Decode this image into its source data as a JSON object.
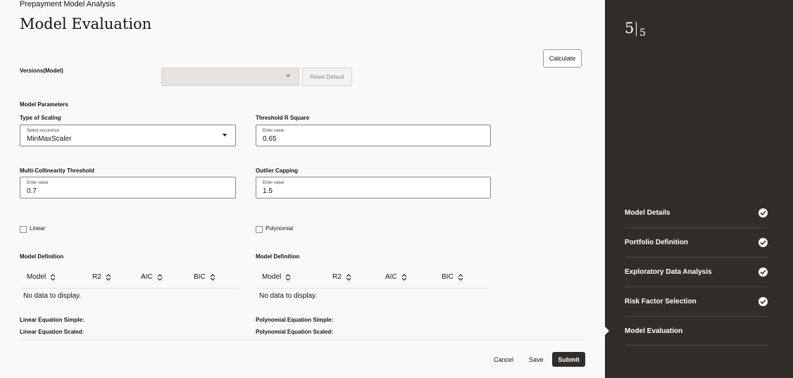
{
  "breadcrumb": "Prepayment Model Analysis",
  "page_title": "Model Evaluation",
  "buttons": {
    "calculate": "Calculate",
    "reset_default": "Reset Default",
    "cancel": "Cancel",
    "save": "Save",
    "submit": "Submit"
  },
  "versions": {
    "label": "Versions(Model)",
    "value": ""
  },
  "model_parameters": {
    "section_label": "Model Parameters",
    "scaling": {
      "label": "Type of Scaling",
      "hint": "Select occurence",
      "value": "MinMaxScaler"
    },
    "threshold_r_square": {
      "label": "Threshold R Square",
      "hint": "Enter value",
      "value": "0.65"
    },
    "multi_collinearity": {
      "label": "Multi-Collinearity Threshold",
      "hint": "Enter value",
      "value": "0.7"
    },
    "outlier_capping": {
      "label": "Outlier Capping",
      "hint": "Enter value",
      "value": "1.5"
    }
  },
  "checkboxes": {
    "linear": {
      "label": "Linear",
      "checked": false
    },
    "polynomial": {
      "label": "Polynomial",
      "checked": false
    }
  },
  "linear_table": {
    "title": "Model Definition",
    "columns": [
      "Model",
      "R2",
      "AIC",
      "BIC"
    ],
    "empty_text": "No data to display.",
    "eq_simple": "Linear Equation Simple:",
    "eq_scaled": "Linear Equation Scaled:"
  },
  "poly_table": {
    "title": "Model Definition",
    "columns": [
      "Model",
      "R2",
      "AIC",
      "BIC"
    ],
    "empty_text": "No data to display.",
    "eq_simple": "Polynomial Equation Simple:",
    "eq_scaled": "Polynomial Equation Scaled:"
  },
  "stepper": {
    "current": "5",
    "total": "5",
    "steps": [
      {
        "label": "Model Details",
        "done": true
      },
      {
        "label": "Portfolio Definition",
        "done": true
      },
      {
        "label": "Exploratory Data Analysis",
        "done": true
      },
      {
        "label": "Risk Factor Selection",
        "done": true
      },
      {
        "label": "Model Evaluation",
        "done": false,
        "active": true
      }
    ]
  },
  "icons": {
    "sort": "sort-icon",
    "check": "check-circle-icon",
    "caret": "chevron-down-icon"
  }
}
